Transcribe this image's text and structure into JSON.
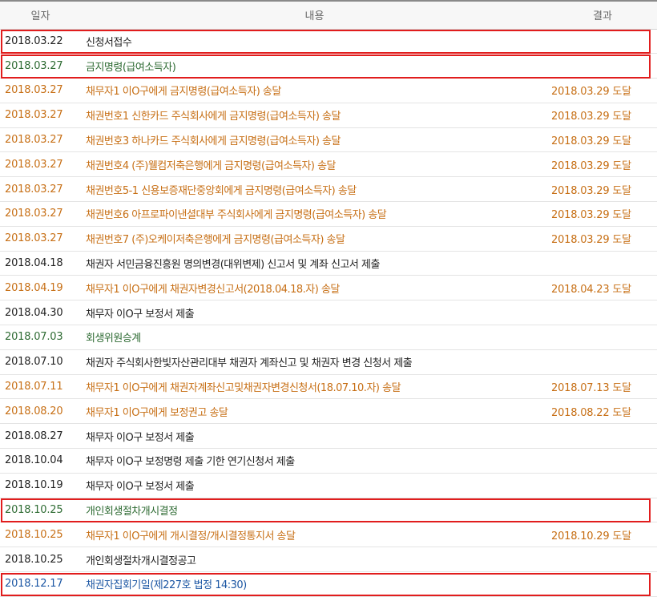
{
  "colors": {
    "default_text": "#222222",
    "delivery_text": "#c76f15",
    "decision_text": "#2e6b33",
    "creditors_meeting_text": "#1b56a3",
    "highlight_box": "#e11d1d",
    "header_background": "#f7f7f7"
  },
  "header": {
    "date": "일자",
    "content": "내용",
    "result": "결과"
  },
  "rows": [
    {
      "date": "2018.03.22",
      "content": "신청서접수",
      "result": "",
      "style": "default",
      "highlighted": true
    },
    {
      "date": "2018.03.27",
      "content": "금지명령(급여소득자)",
      "result": "",
      "style": "decision",
      "highlighted": true
    },
    {
      "date": "2018.03.27",
      "content": "채무자1 이O구에게 금지명령(급여소득자) 송달",
      "result": "2018.03.29 도달",
      "style": "delivery",
      "highlighted": false
    },
    {
      "date": "2018.03.27",
      "content": "채권번호1 신한카드 주식회사에게 금지명령(급여소득자) 송달",
      "result": "2018.03.29 도달",
      "style": "delivery",
      "highlighted": false
    },
    {
      "date": "2018.03.27",
      "content": "채권번호3 하나카드 주식회사에게 금지명령(급여소득자) 송달",
      "result": "2018.03.29 도달",
      "style": "delivery",
      "highlighted": false
    },
    {
      "date": "2018.03.27",
      "content": "채권번호4 (주)웰컴저축은행에게 금지명령(급여소득자) 송달",
      "result": "2018.03.29 도달",
      "style": "delivery",
      "highlighted": false
    },
    {
      "date": "2018.03.27",
      "content": "채권번호5-1 신용보증재단중앙회에게 금지명령(급여소득자) 송달",
      "result": "2018.03.29 도달",
      "style": "delivery",
      "highlighted": false
    },
    {
      "date": "2018.03.27",
      "content": "채권번호6 아프로파이낸셜대부 주식회사에게 금지명령(급여소득자) 송달",
      "result": "2018.03.29 도달",
      "style": "delivery",
      "highlighted": false
    },
    {
      "date": "2018.03.27",
      "content": "채권번호7 (주)오케이저축은행에게 금지명령(급여소득자) 송달",
      "result": "2018.03.29 도달",
      "style": "delivery",
      "highlighted": false
    },
    {
      "date": "2018.04.18",
      "content": "채권자 서민금융진흥원 명의변경(대위변제) 신고서 및 계좌 신고서 제출",
      "result": "",
      "style": "default",
      "highlighted": false
    },
    {
      "date": "2018.04.19",
      "content": "채무자1 이O구에게 채권자변경신고서(2018.04.18.자) 송달",
      "result": "2018.04.23 도달",
      "style": "delivery",
      "highlighted": false
    },
    {
      "date": "2018.04.30",
      "content": "채무자 이O구 보정서 제출",
      "result": "",
      "style": "default",
      "highlighted": false
    },
    {
      "date": "2018.07.03",
      "content": "회생위원승계",
      "result": "",
      "style": "decision",
      "highlighted": false
    },
    {
      "date": "2018.07.10",
      "content": "채권자 주식회사한빛자산관리대부 채권자 계좌신고 및 채권자 변경 신청서 제출",
      "result": "",
      "style": "default",
      "highlighted": false
    },
    {
      "date": "2018.07.11",
      "content": "채무자1 이O구에게 채권자계좌신고및채권자변경신청서(18.07.10.자) 송달",
      "result": "2018.07.13 도달",
      "style": "delivery",
      "highlighted": false
    },
    {
      "date": "2018.08.20",
      "content": "채무자1 이O구에게 보정권고 송달",
      "result": "2018.08.22 도달",
      "style": "delivery",
      "highlighted": false
    },
    {
      "date": "2018.08.27",
      "content": "채무자 이O구 보정서 제출",
      "result": "",
      "style": "default",
      "highlighted": false
    },
    {
      "date": "2018.10.04",
      "content": "채무자 이O구 보정명령 제출 기한 연기신청서 제출",
      "result": "",
      "style": "default",
      "highlighted": false
    },
    {
      "date": "2018.10.19",
      "content": "채무자 이O구 보정서 제출",
      "result": "",
      "style": "default",
      "highlighted": false
    },
    {
      "date": "2018.10.25",
      "content": "개인회생절차개시결정",
      "result": "",
      "style": "decision",
      "highlighted": true
    },
    {
      "date": "2018.10.25",
      "content": "채무자1 이O구에게 개시결정/개시결정통지서 송달",
      "result": "2018.10.29 도달",
      "style": "delivery",
      "highlighted": false
    },
    {
      "date": "2018.10.25",
      "content": "개인회생절차개시결정공고",
      "result": "",
      "style": "default",
      "highlighted": false
    },
    {
      "date": "2018.12.17",
      "content": "채권자집회기일(제227호 법정 14:30)",
      "result": "",
      "style": "meeting",
      "highlighted": true
    }
  ]
}
